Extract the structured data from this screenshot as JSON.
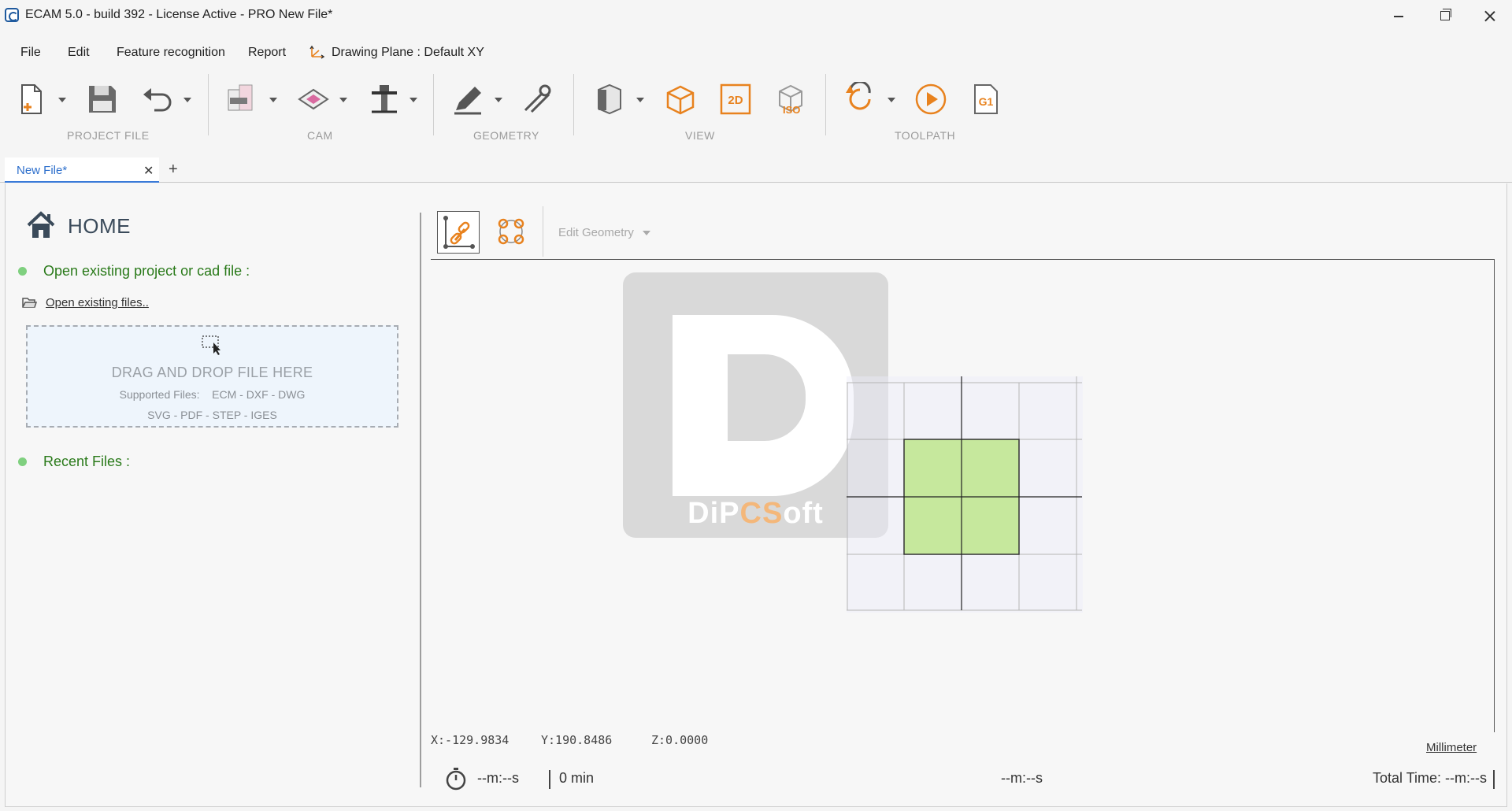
{
  "window": {
    "title": "ECAM 5.0 - build 392 - License Active -  PRO  New File*"
  },
  "menu": {
    "items": [
      "File",
      "Edit",
      "Feature recognition",
      "Report"
    ],
    "drawing_plane": "Drawing Plane : Default XY"
  },
  "toolbar": {
    "groups": [
      {
        "label": "PROJECT FILE",
        "icons": [
          "new-file-icon",
          "save-icon",
          "undo-icon"
        ]
      },
      {
        "label": "CAM",
        "icons": [
          "machine-setup-icon",
          "pocket-operation-icon",
          "tool-library-icon"
        ]
      },
      {
        "label": "GEOMETRY",
        "icons": [
          "draw-pencil-icon",
          "measure-tools-icon"
        ]
      },
      {
        "label": "VIEW",
        "icons": [
          "view-cube-icon",
          "view-3d-icon",
          "view-2d-icon",
          "view-iso-icon"
        ]
      },
      {
        "label": "TOOLPATH",
        "icons": [
          "regenerate-icon",
          "simulate-play-icon",
          "gcode-g1-icon"
        ]
      }
    ],
    "view_2d_label": "2D",
    "view_iso_label": "ISO",
    "gcode_label": "G1",
    "accent_color": "#e8821e"
  },
  "tabs": {
    "active_label": "New File*",
    "close_symbol": "✕",
    "add_symbol": "+"
  },
  "home": {
    "title": "HOME",
    "open_section": "Open existing project or cad file :",
    "open_link": "Open existing files..",
    "dropzone": {
      "title": "DRAG AND DROP FILE HERE",
      "supported_label": "Supported Files:",
      "formats_line1": "ECM - DXF - DWG",
      "formats_line2": "SVG - PDF - STEP - IGES"
    },
    "recent_section": "Recent Files :"
  },
  "viewport": {
    "edit_geometry_label": "Edit Geometry",
    "logo_text_white_1": "DiP",
    "logo_text_orange": "CS",
    "logo_text_white_2": "oft",
    "coord_x": "X:-129.9834",
    "coord_y": "Y:190.8486",
    "coord_z": "Z:0.0000",
    "unit": "Millimeter"
  },
  "status": {
    "timer_value": "--m:--s",
    "duration": "0 min",
    "middle_time": "--m:--s",
    "total_time": "Total Time: --m:--s"
  }
}
